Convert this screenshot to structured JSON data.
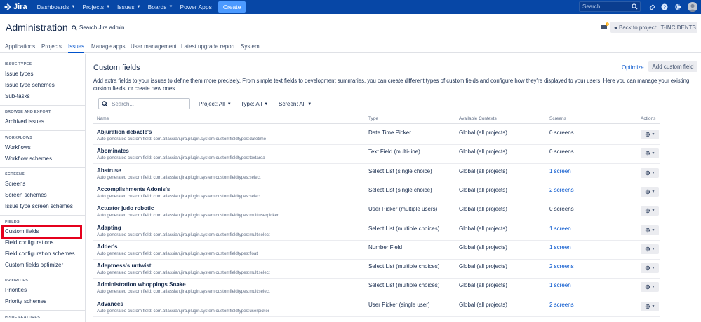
{
  "topbar": {
    "logo": "Jira",
    "nav": [
      "Dashboards",
      "Projects",
      "Issues",
      "Boards",
      "Power Apps"
    ],
    "create": "Create",
    "search_placeholder": "Search"
  },
  "admin": {
    "title": "Administration",
    "search": "Search Jira admin",
    "back": "Back to project: IT-INCIDENTS",
    "feedback_badge": "1"
  },
  "tabs": [
    "Applications",
    "Projects",
    "Issues",
    "Manage apps",
    "User management",
    "Latest upgrade report",
    "System"
  ],
  "active_tab": "Issues",
  "sidebar": {
    "sections": [
      {
        "head": "ISSUE TYPES",
        "items": [
          "Issue types",
          "Issue type schemes",
          "Sub-tasks"
        ]
      },
      {
        "head": "BROWSE AND EXPORT",
        "items": [
          "Archived issues"
        ]
      },
      {
        "head": "WORKFLOWS",
        "items": [
          "Workflows",
          "Workflow schemes"
        ]
      },
      {
        "head": "SCREENS",
        "items": [
          "Screens",
          "Screen schemes",
          "Issue type screen schemes"
        ]
      },
      {
        "head": "FIELDS",
        "items": [
          "Custom fields",
          "Field configurations",
          "Field configuration schemes",
          "Custom fields optimizer"
        ]
      },
      {
        "head": "PRIORITIES",
        "items": [
          "Priorities",
          "Priority schemes"
        ]
      },
      {
        "head": "ISSUE FEATURES",
        "items": []
      }
    ]
  },
  "main": {
    "title": "Custom fields",
    "optimize": "Optimize",
    "add": "Add custom field",
    "description": "Add extra fields to your issues to define them more precisely. From simple text fields to development summaries, you can create different types of custom fields and configure how they're displayed to your users. Here you can manage your existing custom fields, or create new ones.",
    "filter_search_placeholder": "Search...",
    "filters": {
      "project": "Project: All",
      "type": "Type: All",
      "screen": "Screen: All"
    },
    "columns": {
      "name": "Name",
      "type": "Type",
      "contexts": "Available Contexts",
      "screens": "Screens",
      "actions": "Actions"
    },
    "rows": [
      {
        "name": "Abjuration debacle's",
        "desc": "Auto generated custom field: com.atlassian.jira.plugin.system.customfieldtypes:datetime",
        "type": "Date Time Picker",
        "context": "Global (all projects)",
        "screens": "0 screens",
        "link": false
      },
      {
        "name": "Abominates",
        "desc": "Auto generated custom field: com.atlassian.jira.plugin.system.customfieldtypes:textarea",
        "type": "Text Field (multi-line)",
        "context": "Global (all projects)",
        "screens": "0 screens",
        "link": false
      },
      {
        "name": "Abstruse",
        "desc": "Auto generated custom field: com.atlassian.jira.plugin.system.customfieldtypes:select",
        "type": "Select List (single choice)",
        "context": "Global (all projects)",
        "screens": "1 screen",
        "link": true
      },
      {
        "name": "Accomplishments Adonis's",
        "desc": "Auto generated custom field: com.atlassian.jira.plugin.system.customfieldtypes:select",
        "type": "Select List (single choice)",
        "context": "Global (all projects)",
        "screens": "2 screens",
        "link": true
      },
      {
        "name": "Actuator judo robotic",
        "desc": "Auto generated custom field: com.atlassian.jira.plugin.system.customfieldtypes:multiuserpicker",
        "type": "User Picker (multiple users)",
        "context": "Global (all projects)",
        "screens": "0 screens",
        "link": false
      },
      {
        "name": "Adapting",
        "desc": "Auto generated custom field: com.atlassian.jira.plugin.system.customfieldtypes:multiselect",
        "type": "Select List (multiple choices)",
        "context": "Global (all projects)",
        "screens": "1 screen",
        "link": true
      },
      {
        "name": "Adder's",
        "desc": "Auto generated custom field: com.atlassian.jira.plugin.system.customfieldtypes:float",
        "type": "Number Field",
        "context": "Global (all projects)",
        "screens": "1 screen",
        "link": true
      },
      {
        "name": "Adeptness's untwist",
        "desc": "Auto generated custom field: com.atlassian.jira.plugin.system.customfieldtypes:multiselect",
        "type": "Select List (multiple choices)",
        "context": "Global (all projects)",
        "screens": "2 screens",
        "link": true
      },
      {
        "name": "Administration whoppings Snake",
        "desc": "Auto generated custom field: com.atlassian.jira.plugin.system.customfieldtypes:multiselect",
        "type": "Select List (multiple choices)",
        "context": "Global (all projects)",
        "screens": "1 screen",
        "link": true
      },
      {
        "name": "Advances",
        "desc": "Auto generated custom field: com.atlassian.jira.plugin.system.customfieldtypes:userpicker",
        "type": "User Picker (single user)",
        "context": "Global (all projects)",
        "screens": "2 screens",
        "link": true
      }
    ]
  },
  "colors": {
    "nav_bg": "#0747a6",
    "create": "#4c9aff",
    "link": "#0052cc",
    "highlight": "#e5001c"
  }
}
